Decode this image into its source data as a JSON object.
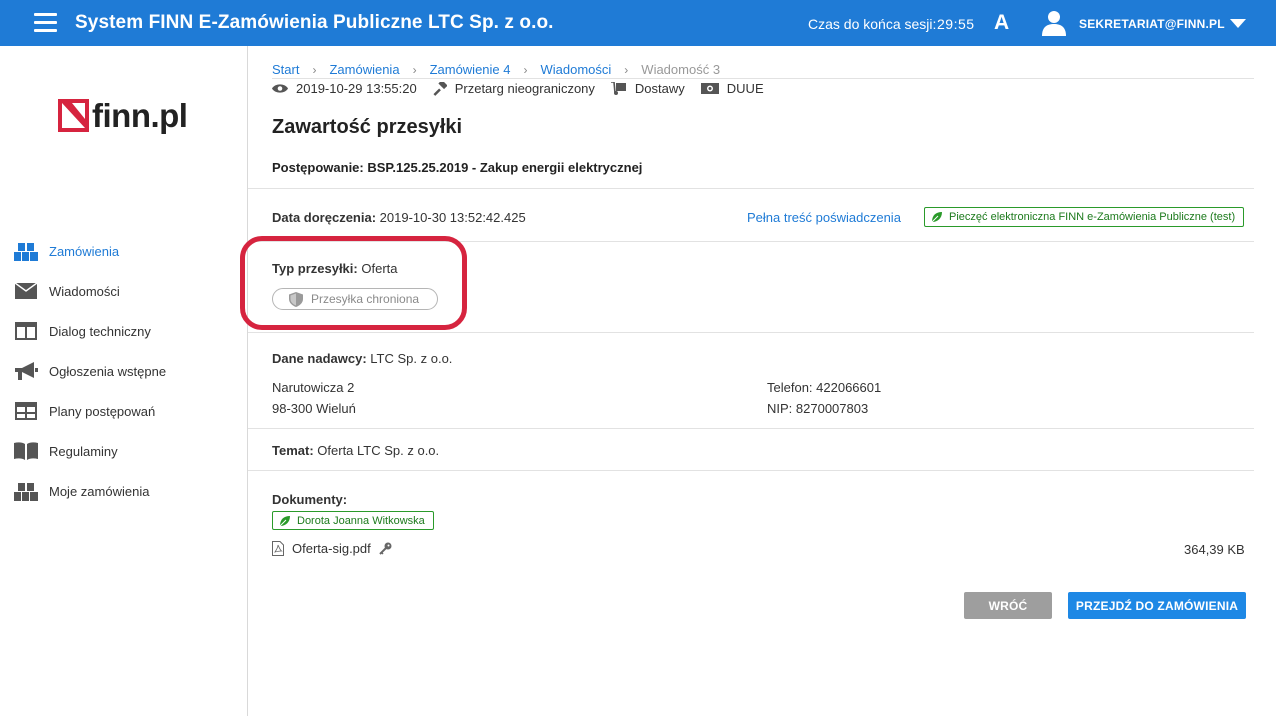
{
  "header": {
    "title": "System FINN E-Zamówienia Publiczne LTC Sp. z o.o.",
    "session_label": "Czas do końca sesji:",
    "session_time": "29:55",
    "font_toggle": "A",
    "user": "SEKRETARIAT@FINN.PL"
  },
  "logo": {
    "text": "finn.pl"
  },
  "sidebar": {
    "items": [
      {
        "label": "Zamówienia",
        "icon": "boxes-icon",
        "active": true
      },
      {
        "label": "Wiadomości",
        "icon": "envelope-icon"
      },
      {
        "label": "Dialog techniczny",
        "icon": "columns-icon"
      },
      {
        "label": "Ogłoszenia wstępne",
        "icon": "megaphone-icon"
      },
      {
        "label": "Plany postępowań",
        "icon": "table-icon"
      },
      {
        "label": "Regulaminy",
        "icon": "book-icon"
      },
      {
        "label": "Moje zamówienia",
        "icon": "boxes-icon"
      }
    ]
  },
  "breadcrumb": [
    "Start",
    "Zamówienia",
    "Zamówienie 4",
    "Wiadomości",
    "Wiadomość 3"
  ],
  "meta": {
    "date": "2019-10-29 13:55:20",
    "mode": "Przetarg nieograniczony",
    "type": "Dostawy",
    "duue": "DUUE"
  },
  "page": {
    "title": "Zawartość przesyłki",
    "procedure": "Postępowanie: BSP.125.25.2019 - Zakup energii elektrycznej",
    "delivery_label": "Data doręczenia:",
    "delivery_value": "2019-10-30 13:52:42.425",
    "cert_link": "Pełna treść poświadczenia",
    "stamp": "Pieczęć elektroniczna FINN e-Zamówienia Publiczne (test)",
    "type_label": "Typ przesyłki:",
    "type_value": "Oferta",
    "protected": "Przesyłka chroniona",
    "sender_label": "Dane nadawcy:",
    "sender_value": "LTC Sp. z o.o.",
    "address1": "Narutowicza 2",
    "address2": "98-300 Wieluń",
    "phone": "Telefon: 422066601",
    "nip": "NIP: 8270007803",
    "subject_label": "Temat:",
    "subject_value": "Oferta LTC Sp. z o.o.",
    "documents_label": "Dokumenty:",
    "signer": "Dorota Joanna Witkowska",
    "file_name": "Oferta-sig.pdf",
    "file_size": "364,39 KB"
  },
  "buttons": {
    "back": "WRÓĆ",
    "go": "PRZEJDŹ DO ZAMÓWIENIA"
  },
  "colors": {
    "primary": "#1f7bd6",
    "highlight": "#d6243f",
    "stamp_green": "#2a9a2a",
    "logo_red": "#d6243f"
  }
}
